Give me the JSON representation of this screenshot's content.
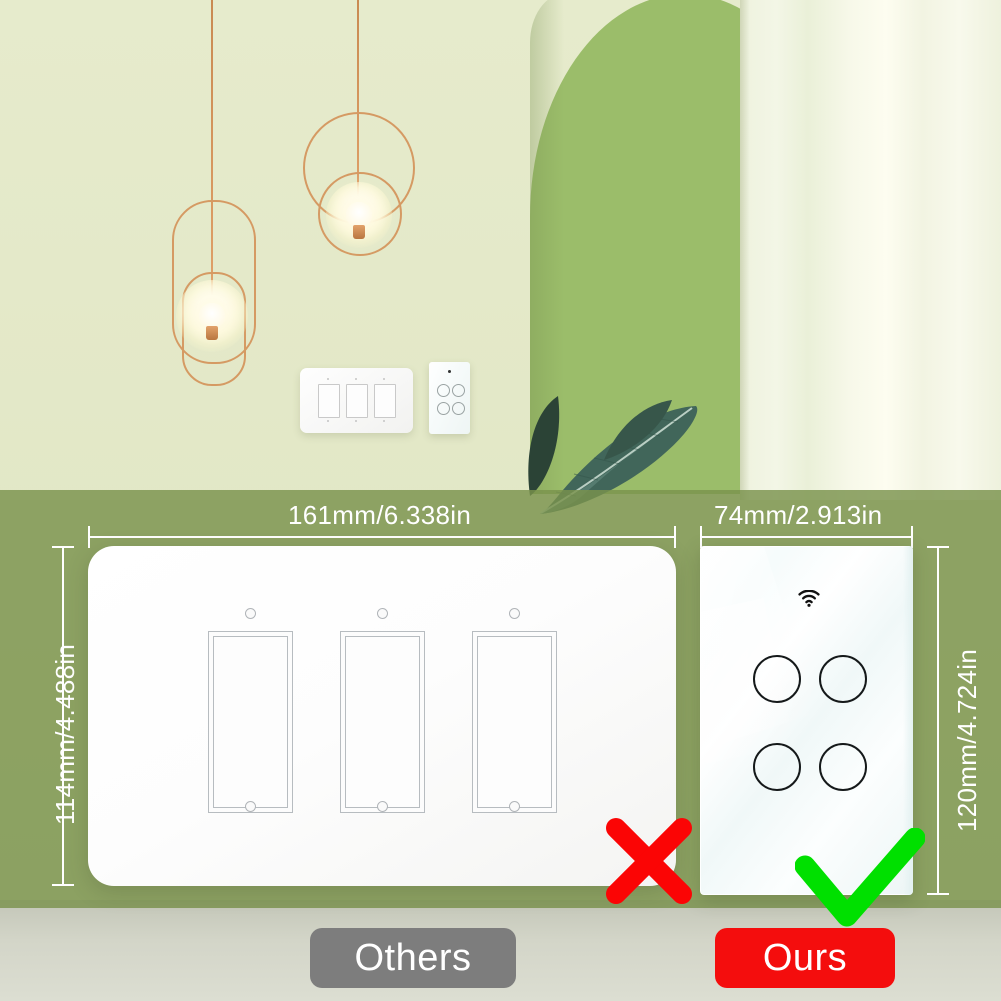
{
  "scene": {
    "wall_color": "#e4e9c9",
    "arch_color": "#9bbd6a",
    "curtain_color": "#f5f7e6",
    "floor_color": "#d3d5c8",
    "lamp_metal_color": "#d59a63",
    "lamp_count": 2,
    "mini_others_switch": "others-3-gang-rocker-plate",
    "mini_ours_switch": "ours-4-gang-touch-glass-panel"
  },
  "overlay": {
    "tint_color": "#7a924d"
  },
  "comparison": {
    "others": {
      "label": "Others",
      "badge_color": "#7d7d7d",
      "mark": "cross",
      "mark_color": "#fb0505",
      "width_label": "161mm/6.338in",
      "height_label": "114mm/4.488in",
      "width_mm": 161,
      "width_in": 6.338,
      "height_mm": 114,
      "height_in": 4.488,
      "gang_count": 3,
      "screw_count": 6,
      "type": "rocker-switch-wall-plate"
    },
    "ours": {
      "label": "Ours",
      "badge_color": "#f40d0d",
      "mark": "check",
      "mark_color": "#00e000",
      "width_label": "74mm/2.913in",
      "height_label": "120mm/4.724in",
      "width_mm": 74,
      "width_in": 2.913,
      "height_mm": 120,
      "height_in": 4.724,
      "button_count": 4,
      "icons": [
        "wifi-icon"
      ],
      "type": "smart-touch-glass-panel"
    }
  }
}
